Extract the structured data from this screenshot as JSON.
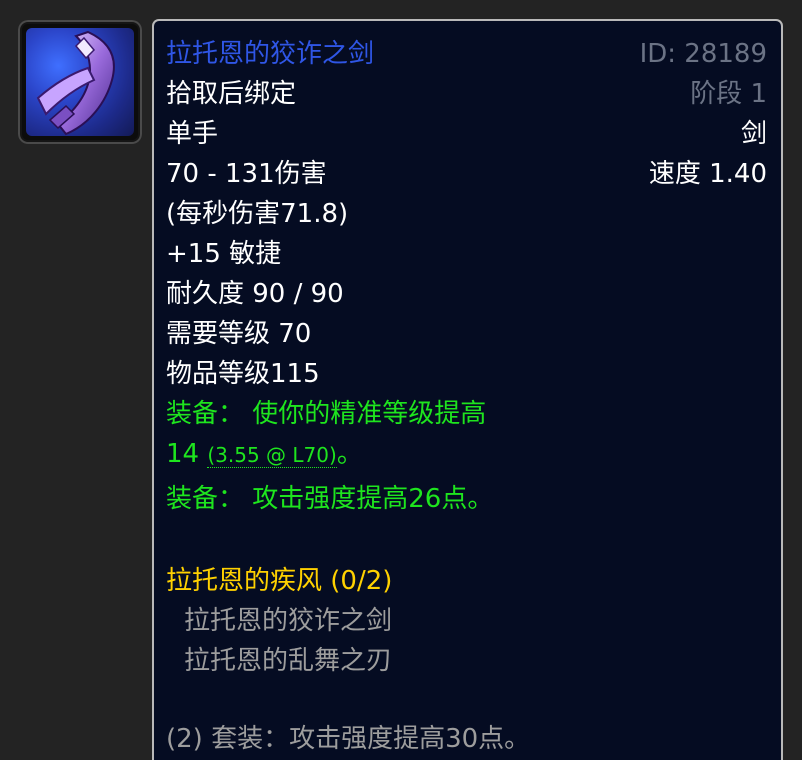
{
  "item": {
    "name": "拉托恩的狡诈之剑",
    "id_label": "ID: 28189",
    "phase_label": "阶段 1",
    "bind": "拾取后绑定",
    "slot": "单手",
    "type": "剑",
    "damage": "70 - 131伤害",
    "speed": "速度 1.40",
    "dps": " (每秒伤害71.8)",
    "agility": "+15 敏捷",
    "durability": "耐久度 90 / 90",
    "req_level": "需要等级 70",
    "item_level": "物品等级115",
    "equip1_line1": "装备： 使你的精准等级提高",
    "equip1_value": "14",
    "equip1_rating": "(3.55 @ L70)",
    "equip1_end": "。",
    "equip2": "装备： 攻击强度提高26点。",
    "set_name": "拉托恩的疾风 (0/2)",
    "set_items": [
      "拉托恩的狡诈之剑",
      "拉托恩的乱舞之刃"
    ],
    "set_bonus": "(2) 套装：攻击强度提高30点。"
  },
  "colors": {
    "name": "#2f56e6",
    "equip": "#1ee51e",
    "set": "#ffd100",
    "inactive": "#9d9d9d",
    "meta": "#6b7385"
  },
  "icon": "sword-hilt-icon"
}
